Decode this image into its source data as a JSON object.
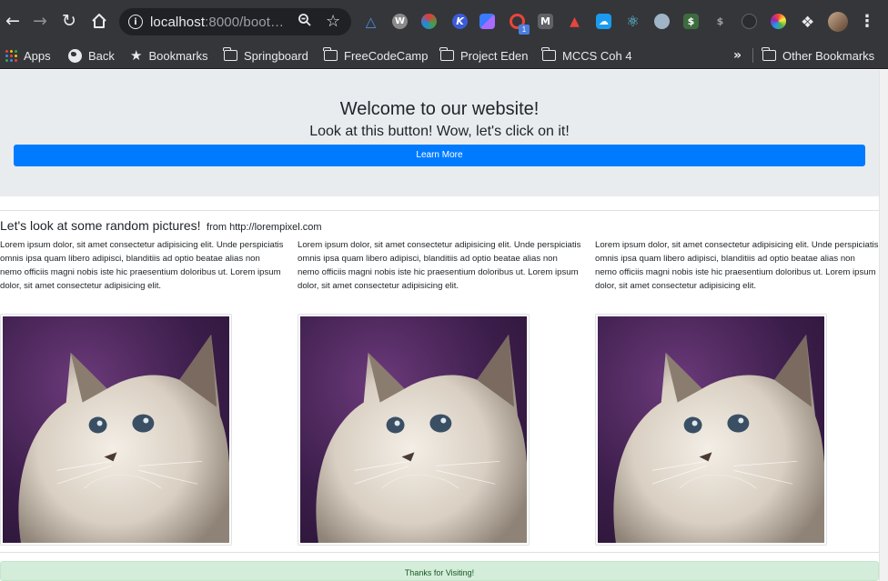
{
  "browser": {
    "url_host": "localhost",
    "url_rest": ":8000/boot…",
    "bookmarks": [
      {
        "label": "Apps",
        "icon": "apps-grid-icon"
      },
      {
        "label": "Back",
        "icon": "globe-icon"
      },
      {
        "label": "Bookmarks",
        "icon": "star-icon"
      },
      {
        "label": "Springboard",
        "icon": "folder-icon"
      },
      {
        "label": "FreeCodeCamp",
        "icon": "folder-icon"
      },
      {
        "label": "Project Eden",
        "icon": "folder-icon"
      },
      {
        "label": "MCCS Coh 4",
        "icon": "folder-icon"
      }
    ],
    "other_bookmarks": "Other Bookmarks",
    "extension_badge": "1",
    "overflow": "»"
  },
  "jumbotron": {
    "title": "Welcome to our website!",
    "subtitle": "Look at this button! Wow, let's click on it!",
    "button_label": "Learn More",
    "button_color": "#007bff",
    "background": "#e9ecef"
  },
  "gallery": {
    "title": "Let's look at some random pictures!",
    "source": "from http://lorempixel.com",
    "cards": [
      {
        "text": "Lorem ipsum dolor, sit amet consectetur adipisicing elit. Unde perspiciatis omnis ipsa quam libero adipisci, blanditiis ad optio beatae alias non nemo officiis magni nobis iste hic praesentium doloribus ut. Lorem ipsum dolor, sit amet consectetur adipisicing elit."
      },
      {
        "text": "Lorem ipsum dolor, sit amet consectetur adipisicing elit. Unde perspiciatis omnis ipsa quam libero adipisci, blanditiis ad optio beatae alias non nemo officiis magni nobis iste hic praesentium doloribus ut. Lorem ipsum dolor, sit amet consectetur adipisicing elit."
      },
      {
        "text": "Lorem ipsum dolor, sit amet consectetur adipisicing elit. Unde perspiciatis omnis ipsa quam libero adipisci, blanditiis ad optio beatae alias non nemo officiis magni nobis iste hic praesentium doloribus ut. Lorem ipsum dolor, sit amet consectetur adipisicing elit."
      }
    ]
  },
  "footer": {
    "text": "Thanks for Visiting!",
    "background": "#d4edda"
  }
}
